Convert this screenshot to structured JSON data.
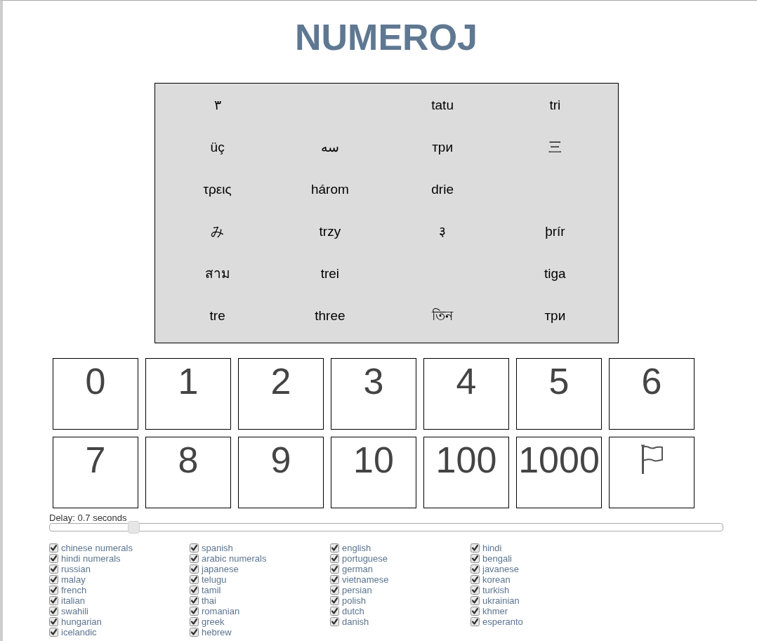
{
  "page": {
    "title": "NUMEROJ"
  },
  "words": {
    "rows": [
      [
        "٣",
        null,
        "tatu",
        "tri"
      ],
      [
        "üç",
        "سه",
        "три",
        "三"
      ],
      [
        "τρεις",
        "három",
        "drie",
        null
      ],
      [
        "み",
        "trzy",
        "३",
        "þrír"
      ],
      [
        "สาม",
        "trei",
        null,
        "tiga"
      ],
      [
        "tre",
        "three",
        "তিন",
        "три"
      ]
    ]
  },
  "tiles": [
    {
      "kind": "number",
      "label": "0"
    },
    {
      "kind": "number",
      "label": "1"
    },
    {
      "kind": "number",
      "label": "2"
    },
    {
      "kind": "number",
      "label": "3"
    },
    {
      "kind": "number",
      "label": "4"
    },
    {
      "kind": "number",
      "label": "5"
    },
    {
      "kind": "number",
      "label": "6"
    },
    {
      "kind": "number",
      "label": "7"
    },
    {
      "kind": "number",
      "label": "8"
    },
    {
      "kind": "number",
      "label": "9"
    },
    {
      "kind": "number",
      "label": "10"
    },
    {
      "kind": "number",
      "label": "100"
    },
    {
      "kind": "number",
      "label": "1000"
    },
    {
      "kind": "flag"
    }
  ],
  "delay": {
    "label": "Delay: 0.7 seconds",
    "level": 0.125
  },
  "languages": [
    {
      "label": "chinese numerals",
      "checked": true
    },
    {
      "label": "spanish",
      "checked": true
    },
    {
      "label": "english",
      "checked": true
    },
    {
      "label": "hindi",
      "checked": true
    },
    {
      "label": "hindi numerals",
      "checked": true
    },
    {
      "label": "arabic numerals",
      "checked": true
    },
    {
      "label": "portuguese",
      "checked": true
    },
    {
      "label": "bengali",
      "checked": true
    },
    {
      "label": "russian",
      "checked": true
    },
    {
      "label": "japanese",
      "checked": true
    },
    {
      "label": "german",
      "checked": true
    },
    {
      "label": "javanese",
      "checked": true
    },
    {
      "label": "malay",
      "checked": true
    },
    {
      "label": "telugu",
      "checked": true
    },
    {
      "label": "vietnamese",
      "checked": true
    },
    {
      "label": "korean",
      "checked": true
    },
    {
      "label": "french",
      "checked": true
    },
    {
      "label": "tamil",
      "checked": true
    },
    {
      "label": "persian",
      "checked": true
    },
    {
      "label": "turkish",
      "checked": true
    },
    {
      "label": "italian",
      "checked": true
    },
    {
      "label": "thai",
      "checked": true
    },
    {
      "label": "polish",
      "checked": true
    },
    {
      "label": "ukrainian",
      "checked": true
    },
    {
      "label": "swahili",
      "checked": true
    },
    {
      "label": "romanian",
      "checked": true
    },
    {
      "label": "dutch",
      "checked": true
    },
    {
      "label": "khmer",
      "checked": true
    },
    {
      "label": "hungarian",
      "checked": true
    },
    {
      "label": "greek",
      "checked": true
    },
    {
      "label": "danish",
      "checked": true
    },
    {
      "label": "esperanto",
      "checked": true
    },
    {
      "label": "icelandic",
      "checked": true
    },
    {
      "label": "hebrew",
      "checked": true
    }
  ]
}
